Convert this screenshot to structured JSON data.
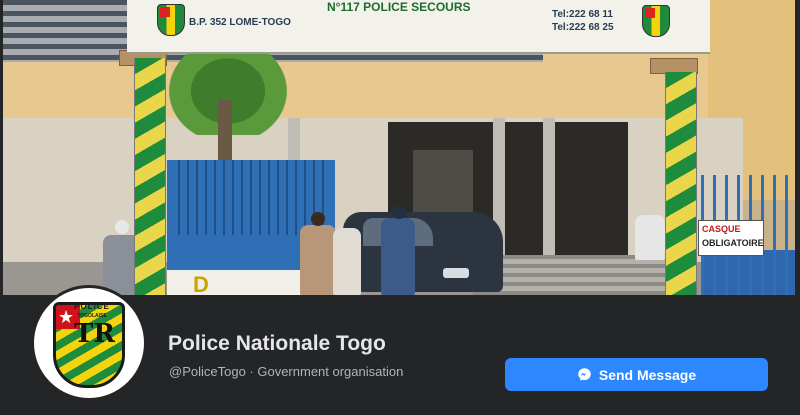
{
  "page": {
    "name": "Police Nationale Togo",
    "username": "@PoliceTogo",
    "separator": " · ",
    "category": "Government organisation"
  },
  "actions": {
    "send_message_label": "Send Message",
    "send_message_icon": "messenger-icon"
  },
  "cover": {
    "banner_main": "N°117 POLICE SECOURS",
    "banner_address": "B.P. 352 LOME-TOGO",
    "banner_tel_1": "Tel:222 68 11",
    "banner_tel_2": "Tel:222 68 25",
    "gate_letter": "D",
    "sign_line_1": "CASQUE",
    "sign_line_2": "OBLIGATOIRE"
  },
  "avatar": {
    "badge_top_text": "POLICE",
    "badge_sub_text": "TOGOLAISE",
    "badge_letters": "TR"
  },
  "colors": {
    "background": "#242526",
    "primary_text": "#e4e6eb",
    "secondary_text": "#b0b3b8",
    "button_blue": "#2d88ff"
  }
}
